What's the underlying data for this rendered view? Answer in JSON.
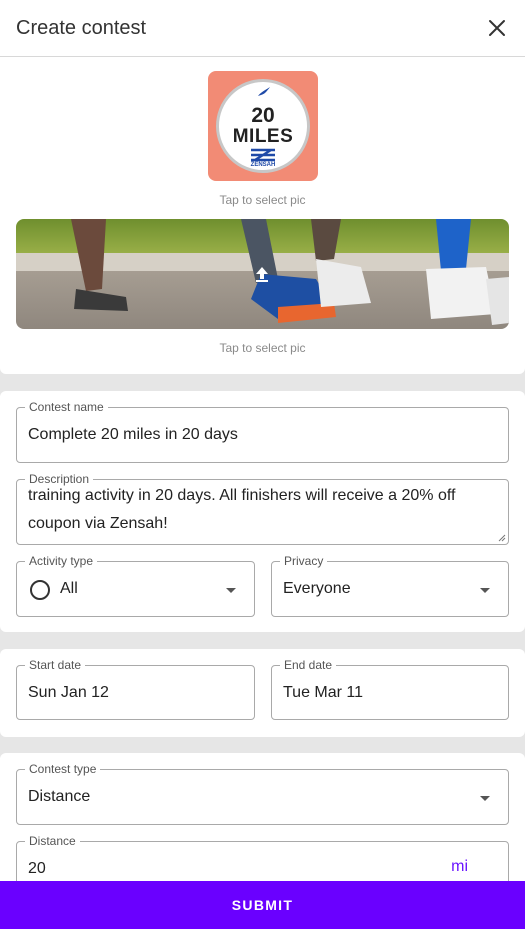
{
  "header": {
    "title": "Create contest",
    "close_icon": "close-icon"
  },
  "media": {
    "avatar_caption": "Tap to select pic",
    "banner_caption": "Tap to select pic",
    "badge": {
      "number": "20",
      "word": "MILES",
      "brand": "ZENSAH"
    }
  },
  "form": {
    "contest_name": {
      "label": "Contest name",
      "value": "Complete 20 miles in 20 days"
    },
    "description": {
      "label": "Description",
      "value": "training activity in 20 days. All finishers will receive a 20% off coupon via Zensah!"
    },
    "activity_type": {
      "label": "Activity type",
      "value": "All",
      "selected": false
    },
    "privacy": {
      "label": "Privacy",
      "value": "Everyone"
    },
    "start_date": {
      "label": "Start date",
      "value": "Sun Jan 12"
    },
    "end_date": {
      "label": "End date",
      "value": "Tue Mar 11"
    },
    "contest_type": {
      "label": "Contest type",
      "value": "Distance"
    },
    "distance": {
      "label": "Distance",
      "value": "20",
      "unit": "mi"
    }
  },
  "submit_label": "SUBMIT",
  "colors": {
    "accent": "#6a00ff",
    "unit_text": "#6a14ff",
    "avatar_bg": "#f28b75"
  }
}
